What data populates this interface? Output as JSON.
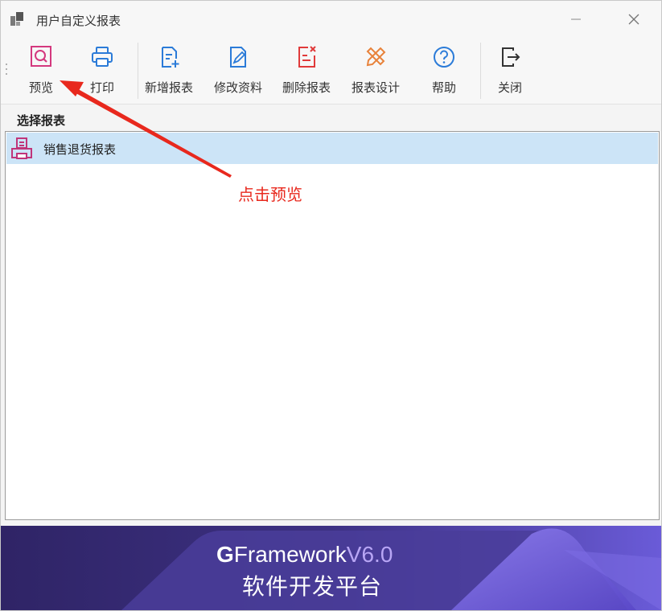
{
  "window": {
    "title": "用户自定义报表"
  },
  "toolbar": {
    "buttons": [
      {
        "label": "预览",
        "icon": "preview-icon",
        "color": "#d4387e"
      },
      {
        "label": "打印",
        "icon": "printer-icon",
        "color": "#2b7bd8"
      },
      {
        "label": "新增报表",
        "icon": "add-report-icon",
        "color": "#2b7bd8"
      },
      {
        "label": "修改资料",
        "icon": "edit-icon",
        "color": "#2b7bd8"
      },
      {
        "label": "删除报表",
        "icon": "delete-report-icon",
        "color": "#e03a3a"
      },
      {
        "label": "报表设计",
        "icon": "design-icon",
        "color": "#e8823a"
      },
      {
        "label": "帮助",
        "icon": "help-icon",
        "color": "#2b7bd8"
      },
      {
        "label": "关闭",
        "icon": "exit-icon",
        "color": "#333333"
      }
    ]
  },
  "section": {
    "title": "选择报表"
  },
  "reports": [
    {
      "label": "销售退货报表",
      "icon": "report-printer-icon",
      "selected": true
    }
  ],
  "annotation": {
    "text": "点击预览",
    "color": "#e8281d"
  },
  "banner": {
    "brand": "Framework",
    "brand_mark": "G",
    "version": "V6.0",
    "subtitle": "软件开发平台",
    "background": "#3a2e78"
  }
}
